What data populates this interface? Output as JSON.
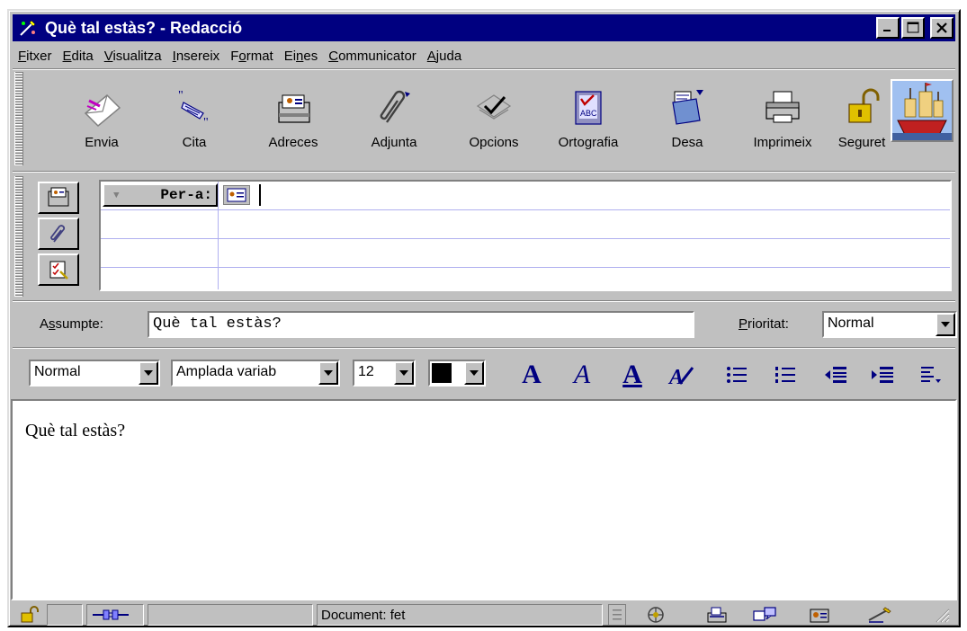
{
  "window": {
    "title": "Què tal estàs? - Redacció",
    "minimize_icon": "minimize-icon",
    "maximize_icon": "maximize-icon",
    "close_icon": "close-icon"
  },
  "menu": [
    {
      "label": "Fitxer",
      "accel": "F"
    },
    {
      "label": "Edita",
      "accel": "E"
    },
    {
      "label": "Visualitza",
      "accel": "V"
    },
    {
      "label": "Insereix",
      "accel": "I"
    },
    {
      "label": "Format",
      "accel": "o"
    },
    {
      "label": "Eines",
      "accel": "n"
    },
    {
      "label": "Communicator",
      "accel": "C"
    },
    {
      "label": "Ajuda",
      "accel": "A"
    }
  ],
  "toolbar": {
    "send": "Envia",
    "quote": "Cita",
    "address": "Adreces",
    "attach": "Adjunta",
    "options": "Opcions",
    "spelling": "Ortografia",
    "save": "Desa",
    "print": "Imprimeix",
    "security": "Seguret"
  },
  "address": {
    "type": "Per-a:",
    "value": ""
  },
  "subject": {
    "label_pre": "A",
    "label_accel": "s",
    "label_post": "sumpte:",
    "value": "Què tal estàs?"
  },
  "priority": {
    "label": "Prioritat:",
    "value": "Normal"
  },
  "format": {
    "paragraph_style": "Normal",
    "font": "Amplada variab",
    "size": "12",
    "color": "#000000"
  },
  "editor": {
    "body": "Què tal estàs?"
  },
  "status": {
    "text": "Document: fet"
  },
  "colors": {
    "titlebar": "#000080",
    "chrome": "#c0c0c0",
    "accent_text": "#000080"
  }
}
